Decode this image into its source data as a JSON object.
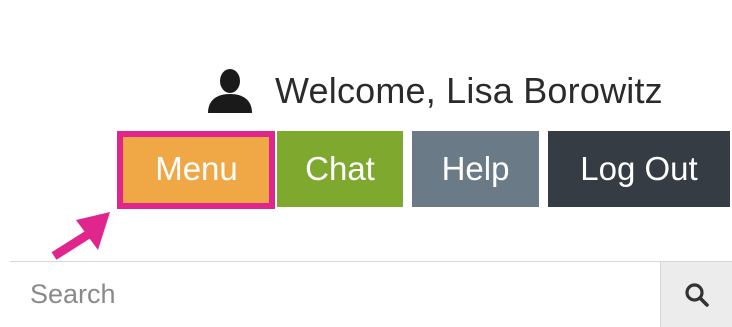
{
  "header": {
    "welcome_text": "Welcome, Lisa Borowitz",
    "user_icon": "user-icon"
  },
  "nav": {
    "menu_label": "Menu",
    "chat_label": "Chat",
    "help_label": "Help",
    "logout_label": "Log Out"
  },
  "search": {
    "placeholder": "Search",
    "value": "",
    "button_icon": "search-icon"
  },
  "colors": {
    "menu": "#f0a846",
    "chat": "#7fa82f",
    "help": "#6a7a86",
    "logout": "#353c44",
    "highlight": "#e0268c"
  }
}
